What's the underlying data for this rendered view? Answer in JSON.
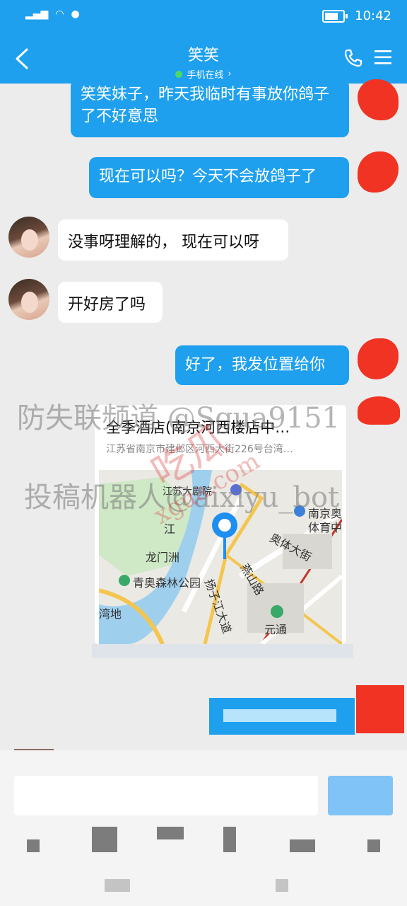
{
  "status_bar": {
    "time": "10:42"
  },
  "header": {
    "contact_name": "笑笑",
    "online_status": "手机在线",
    "chevron": "›"
  },
  "messages": [
    {
      "side": "right",
      "text": "笑笑妹子，昨天我临时有事放你鸽子了不好意思"
    },
    {
      "side": "right",
      "text": "现在可以吗？今天不会放鸽子了"
    },
    {
      "side": "left",
      "text": "没事呀理解的， 现在可以呀"
    },
    {
      "side": "left",
      "text": "开好房了吗"
    },
    {
      "side": "right",
      "text": "好了，我发位置给你"
    }
  ],
  "location_card": {
    "name": "全季酒店(南京河西楼店中…",
    "address": "江苏省南京市建邺区河西大街226号台湾…",
    "map_labels": {
      "stadium": "南京奥",
      "stadium2": "体育中",
      "aoti": "奥体大街",
      "longmen": "龙门洲",
      "park": "青奥森林公园",
      "yanshan": "燕山路",
      "yuantong": "元通",
      "yangzi": "扬子江大道",
      "dadi": "湾地",
      "jiangsu": "江苏大剧院",
      "jiang": "江"
    }
  },
  "watermarks": {
    "line1": "防失联频道 @Sgua9151",
    "line2": "投稿机器人@aixiyu_bot",
    "stamp": "吃瓜",
    "stamp2": "xgua.com"
  },
  "colors": {
    "accent": "#1ea0ef",
    "bubble_left": "#ffffff",
    "bg": "#ececec",
    "avatar_red": "#f03322"
  }
}
